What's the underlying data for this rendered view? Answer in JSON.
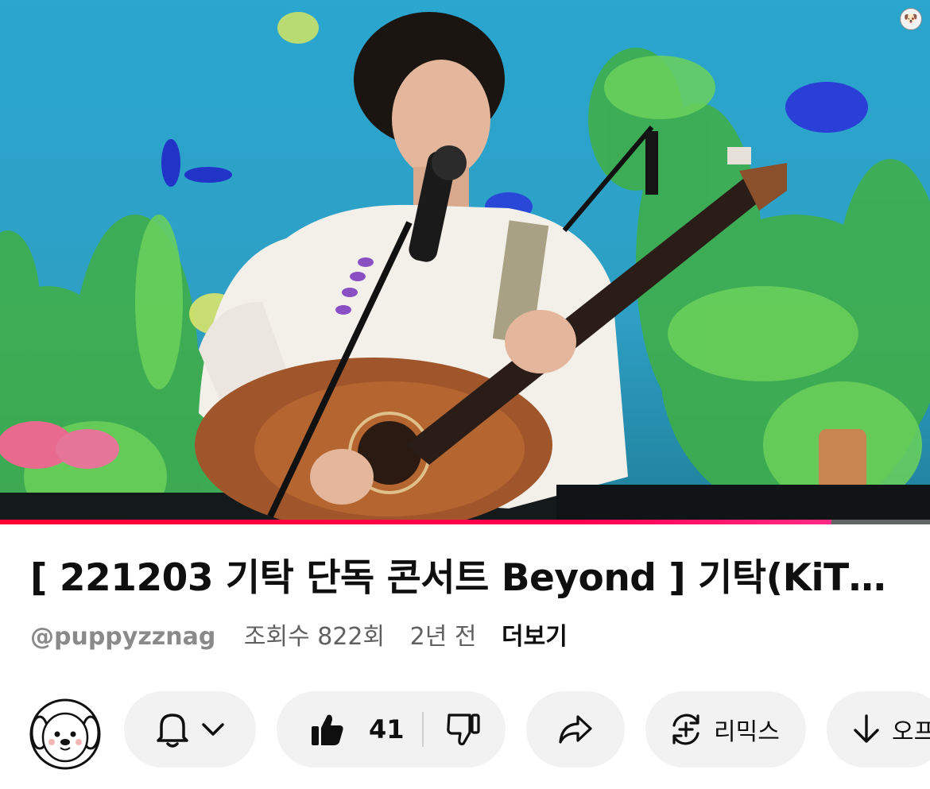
{
  "video": {
    "progress_fraction": 0.894,
    "watermark_icon": "puppy-icon"
  },
  "info": {
    "title": "[ 221203 기탁 단독 콘서트 Beyond ] 기탁(KiT…",
    "channel_handle": "@puppyzznag",
    "views": "조회수 822회",
    "age": "2년 전",
    "more_label": "더보기"
  },
  "actions": {
    "avatar_icon": "puppy-face-avatar",
    "subscribe_bell_icon": "bell-icon",
    "subscribe_dropdown_icon": "chevron-down-icon",
    "like_icon": "thumbs-up-icon",
    "like_count": "41",
    "dislike_icon": "thumbs-down-icon",
    "share_icon": "share-arrow-icon",
    "remix_icon": "remix-icon",
    "remix_label": "리믹스",
    "download_icon": "download-arrow-icon",
    "download_label": "오프"
  },
  "colors": {
    "progress": "#ff0033",
    "pill_bg": "#f2f2f2",
    "text_primary": "#0f0f0f",
    "text_secondary": "#606060"
  }
}
